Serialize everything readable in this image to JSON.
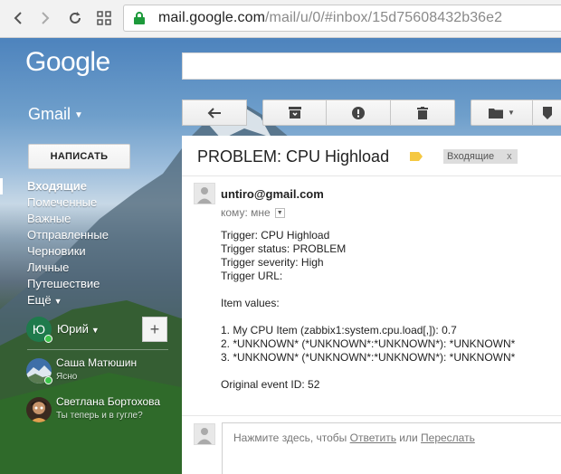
{
  "browser": {
    "url_host": "mail.google.com",
    "url_path": "/mail/u/0/#inbox/15d75608432b36e2"
  },
  "header": {
    "logo": "Google",
    "app_switcher": "Gmail"
  },
  "sidebar": {
    "compose": "НАПИСАТЬ",
    "items": [
      {
        "label": "Входящие",
        "active": true
      },
      {
        "label": "Помеченные"
      },
      {
        "label": "Важные"
      },
      {
        "label": "Отправленные"
      },
      {
        "label": "Черновики"
      },
      {
        "label": "Личные"
      },
      {
        "label": "Путешествие"
      },
      {
        "label": "Ещё"
      }
    ],
    "user": {
      "initial": "Ю",
      "name": "Юрий"
    },
    "contacts": [
      {
        "name": "Саша Матюшин",
        "status": "Ясно"
      },
      {
        "name": "Светлана Бортохова",
        "status": "Ты теперь и в гугле?"
      }
    ]
  },
  "email": {
    "subject": "PROBLEM: CPU Highload",
    "label_chip": "Входящие",
    "label_chip_close": "x",
    "sender": "untiro@gmail.com",
    "to_line": "кому: мне",
    "body": [
      "Trigger: CPU Highload",
      "Trigger status: PROBLEM",
      "Trigger severity: High",
      "Trigger URL:",
      "",
      "Item values:",
      "",
      "1. My CPU Item (zabbix1:system.cpu.load[,]): 0.7",
      "2. *UNKNOWN* (*UNKNOWN*:*UNKNOWN*): *UNKNOWN*",
      "3. *UNKNOWN* (*UNKNOWN*:*UNKNOWN*): *UNKNOWN*",
      "",
      "Original event ID: 52"
    ]
  },
  "reply": {
    "prefix": "Нажмите здесь, чтобы ",
    "reply_link": "Ответить",
    "middle": " или ",
    "forward_link": "Переслать"
  },
  "colors": {
    "label_tag": "#f5c842",
    "online": "#3cc34a",
    "user_avatar": "#1f7a4c"
  }
}
